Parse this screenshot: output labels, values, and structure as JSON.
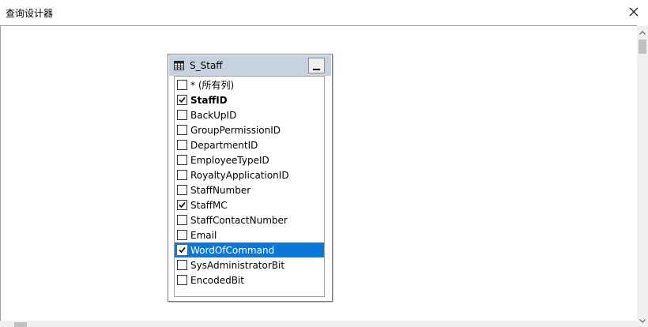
{
  "window": {
    "title": "查询设计器"
  },
  "table": {
    "name": "S_Staff",
    "columns": [
      {
        "label": "* (所有列)",
        "checked": false,
        "bold": false,
        "selected": false
      },
      {
        "label": "StaffID",
        "checked": true,
        "bold": true,
        "selected": false
      },
      {
        "label": "BackUpID",
        "checked": false,
        "bold": false,
        "selected": false
      },
      {
        "label": "GroupPermissionID",
        "checked": false,
        "bold": false,
        "selected": false
      },
      {
        "label": "DepartmentID",
        "checked": false,
        "bold": false,
        "selected": false
      },
      {
        "label": "EmployeeTypeID",
        "checked": false,
        "bold": false,
        "selected": false
      },
      {
        "label": "RoyaltyApplicationID",
        "checked": false,
        "bold": false,
        "selected": false
      },
      {
        "label": "StaffNumber",
        "checked": false,
        "bold": false,
        "selected": false
      },
      {
        "label": "StaffMC",
        "checked": true,
        "bold": false,
        "selected": false
      },
      {
        "label": "StaffContactNumber",
        "checked": false,
        "bold": false,
        "selected": false
      },
      {
        "label": "Email",
        "checked": false,
        "bold": false,
        "selected": false
      },
      {
        "label": "WordOfCommand",
        "checked": true,
        "bold": false,
        "selected": true
      },
      {
        "label": "SysAdministratorBit",
        "checked": false,
        "bold": false,
        "selected": false
      },
      {
        "label": "EncodedBit",
        "checked": false,
        "bold": false,
        "selected": false
      }
    ]
  },
  "icons": {
    "close": "close-icon",
    "table": "table-grid-icon",
    "minimize": "minimize-icon"
  },
  "colors": {
    "header": "#c6d2e0",
    "selection": "#0a78d7",
    "title_border": "#2b579a"
  }
}
